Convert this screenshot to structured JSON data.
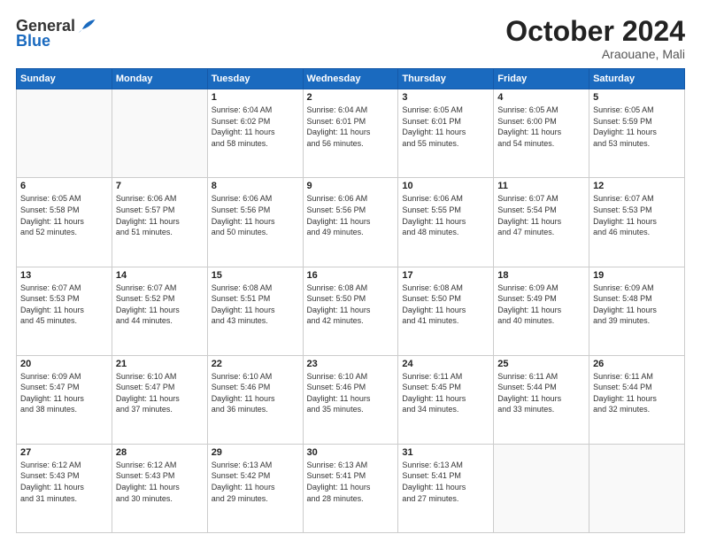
{
  "header": {
    "logo_general": "General",
    "logo_blue": "Blue",
    "month": "October 2024",
    "location": "Araouane, Mali"
  },
  "weekdays": [
    "Sunday",
    "Monday",
    "Tuesday",
    "Wednesday",
    "Thursday",
    "Friday",
    "Saturday"
  ],
  "weeks": [
    [
      {
        "day": "",
        "info": ""
      },
      {
        "day": "",
        "info": ""
      },
      {
        "day": "1",
        "info": "Sunrise: 6:04 AM\nSunset: 6:02 PM\nDaylight: 11 hours\nand 58 minutes."
      },
      {
        "day": "2",
        "info": "Sunrise: 6:04 AM\nSunset: 6:01 PM\nDaylight: 11 hours\nand 56 minutes."
      },
      {
        "day": "3",
        "info": "Sunrise: 6:05 AM\nSunset: 6:01 PM\nDaylight: 11 hours\nand 55 minutes."
      },
      {
        "day": "4",
        "info": "Sunrise: 6:05 AM\nSunset: 6:00 PM\nDaylight: 11 hours\nand 54 minutes."
      },
      {
        "day": "5",
        "info": "Sunrise: 6:05 AM\nSunset: 5:59 PM\nDaylight: 11 hours\nand 53 minutes."
      }
    ],
    [
      {
        "day": "6",
        "info": "Sunrise: 6:05 AM\nSunset: 5:58 PM\nDaylight: 11 hours\nand 52 minutes."
      },
      {
        "day": "7",
        "info": "Sunrise: 6:06 AM\nSunset: 5:57 PM\nDaylight: 11 hours\nand 51 minutes."
      },
      {
        "day": "8",
        "info": "Sunrise: 6:06 AM\nSunset: 5:56 PM\nDaylight: 11 hours\nand 50 minutes."
      },
      {
        "day": "9",
        "info": "Sunrise: 6:06 AM\nSunset: 5:56 PM\nDaylight: 11 hours\nand 49 minutes."
      },
      {
        "day": "10",
        "info": "Sunrise: 6:06 AM\nSunset: 5:55 PM\nDaylight: 11 hours\nand 48 minutes."
      },
      {
        "day": "11",
        "info": "Sunrise: 6:07 AM\nSunset: 5:54 PM\nDaylight: 11 hours\nand 47 minutes."
      },
      {
        "day": "12",
        "info": "Sunrise: 6:07 AM\nSunset: 5:53 PM\nDaylight: 11 hours\nand 46 minutes."
      }
    ],
    [
      {
        "day": "13",
        "info": "Sunrise: 6:07 AM\nSunset: 5:53 PM\nDaylight: 11 hours\nand 45 minutes."
      },
      {
        "day": "14",
        "info": "Sunrise: 6:07 AM\nSunset: 5:52 PM\nDaylight: 11 hours\nand 44 minutes."
      },
      {
        "day": "15",
        "info": "Sunrise: 6:08 AM\nSunset: 5:51 PM\nDaylight: 11 hours\nand 43 minutes."
      },
      {
        "day": "16",
        "info": "Sunrise: 6:08 AM\nSunset: 5:50 PM\nDaylight: 11 hours\nand 42 minutes."
      },
      {
        "day": "17",
        "info": "Sunrise: 6:08 AM\nSunset: 5:50 PM\nDaylight: 11 hours\nand 41 minutes."
      },
      {
        "day": "18",
        "info": "Sunrise: 6:09 AM\nSunset: 5:49 PM\nDaylight: 11 hours\nand 40 minutes."
      },
      {
        "day": "19",
        "info": "Sunrise: 6:09 AM\nSunset: 5:48 PM\nDaylight: 11 hours\nand 39 minutes."
      }
    ],
    [
      {
        "day": "20",
        "info": "Sunrise: 6:09 AM\nSunset: 5:47 PM\nDaylight: 11 hours\nand 38 minutes."
      },
      {
        "day": "21",
        "info": "Sunrise: 6:10 AM\nSunset: 5:47 PM\nDaylight: 11 hours\nand 37 minutes."
      },
      {
        "day": "22",
        "info": "Sunrise: 6:10 AM\nSunset: 5:46 PM\nDaylight: 11 hours\nand 36 minutes."
      },
      {
        "day": "23",
        "info": "Sunrise: 6:10 AM\nSunset: 5:46 PM\nDaylight: 11 hours\nand 35 minutes."
      },
      {
        "day": "24",
        "info": "Sunrise: 6:11 AM\nSunset: 5:45 PM\nDaylight: 11 hours\nand 34 minutes."
      },
      {
        "day": "25",
        "info": "Sunrise: 6:11 AM\nSunset: 5:44 PM\nDaylight: 11 hours\nand 33 minutes."
      },
      {
        "day": "26",
        "info": "Sunrise: 6:11 AM\nSunset: 5:44 PM\nDaylight: 11 hours\nand 32 minutes."
      }
    ],
    [
      {
        "day": "27",
        "info": "Sunrise: 6:12 AM\nSunset: 5:43 PM\nDaylight: 11 hours\nand 31 minutes."
      },
      {
        "day": "28",
        "info": "Sunrise: 6:12 AM\nSunset: 5:43 PM\nDaylight: 11 hours\nand 30 minutes."
      },
      {
        "day": "29",
        "info": "Sunrise: 6:13 AM\nSunset: 5:42 PM\nDaylight: 11 hours\nand 29 minutes."
      },
      {
        "day": "30",
        "info": "Sunrise: 6:13 AM\nSunset: 5:41 PM\nDaylight: 11 hours\nand 28 minutes."
      },
      {
        "day": "31",
        "info": "Sunrise: 6:13 AM\nSunset: 5:41 PM\nDaylight: 11 hours\nand 27 minutes."
      },
      {
        "day": "",
        "info": ""
      },
      {
        "day": "",
        "info": ""
      }
    ]
  ]
}
